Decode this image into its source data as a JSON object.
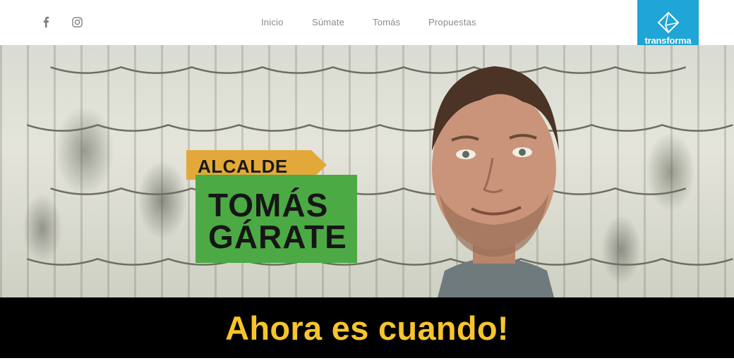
{
  "header": {
    "social": [
      {
        "icon": "facebook-icon",
        "label": "f"
      },
      {
        "icon": "instagram-icon"
      }
    ],
    "nav": [
      "Inicio",
      "Súmate",
      "Tomás",
      "Propuestas"
    ],
    "logo": {
      "text": "transforma",
      "icon": "diamond-outline-icon",
      "color": "#1fa5d6"
    }
  },
  "hero": {
    "badge_small": "ALCALDE",
    "name_line1": "TOMÁS",
    "name_line2": "GÁRATE",
    "badge_small_color": "#e2a93a",
    "badge_name_color": "#4caa45"
  },
  "banner": {
    "slogan": "Ahora es cuando!",
    "text_color": "#f7c42c",
    "background": "#000000"
  }
}
